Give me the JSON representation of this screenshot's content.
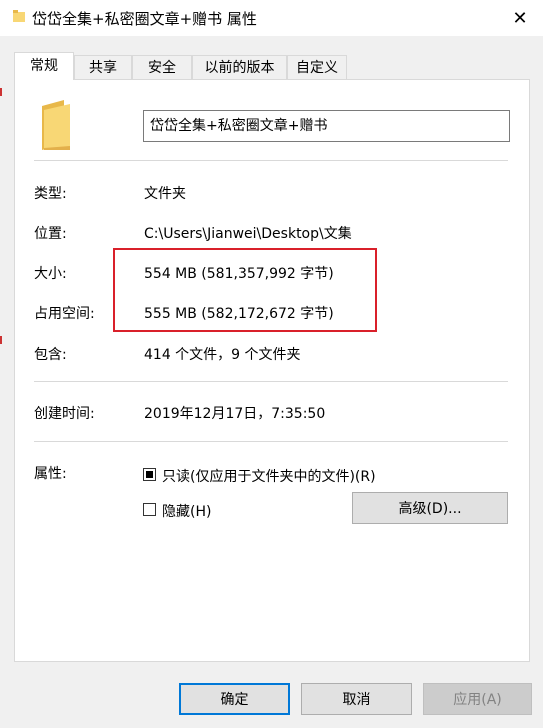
{
  "window": {
    "title": "岱岱全集+私密圈文章+赠书 属性",
    "close_glyph": "✕"
  },
  "tabs": [
    {
      "label": "常规",
      "active": true
    },
    {
      "label": "共享",
      "active": false
    },
    {
      "label": "安全",
      "active": false
    },
    {
      "label": "以前的版本",
      "active": false
    },
    {
      "label": "自定义",
      "active": false
    }
  ],
  "general": {
    "folder_name": "岱岱全集+私密圈文章+赠书",
    "type_label": "类型:",
    "type_value": "文件夹",
    "location_label": "位置:",
    "location_value": "C:\\Users\\Jianwei\\Desktop\\文集",
    "size_label": "大小:",
    "size_value": "554 MB (581,357,992 字节)",
    "size_on_disk_label": "占用空间:",
    "size_on_disk_value": "555 MB (582,172,672 字节)",
    "contains_label": "包含:",
    "contains_value": "414 个文件，9 个文件夹",
    "created_label": "创建时间:",
    "created_value": "2019年12月17日，7:35:50",
    "attributes_label": "属性:",
    "readonly_label": "只读(仅应用于文件夹中的文件)(R)",
    "readonly_state": "indeterminate",
    "hidden_label": "隐藏(H)",
    "hidden_checked": false,
    "advanced_button": "高级(D)..."
  },
  "footer": {
    "ok": "确定",
    "cancel": "取消",
    "apply": "应用(A)"
  },
  "colors": {
    "highlight_border": "#d9202a",
    "folder_yellow": "#f8d775",
    "primary_border": "#0078d7"
  }
}
